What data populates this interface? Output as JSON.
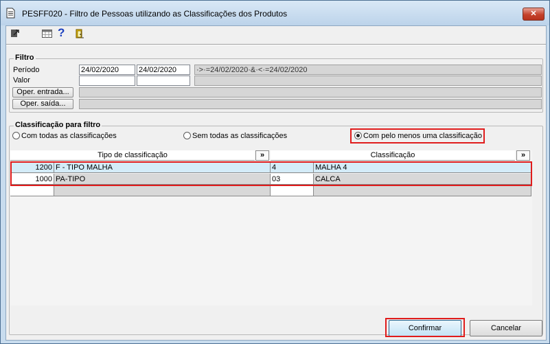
{
  "window": {
    "title": "PESFF020 - Filtro de Pessoas utilizando as Classificações dos Produtos",
    "close_label": "✕"
  },
  "toolbar": {
    "icons": [
      "exit-icon",
      "calendar-grid-icon",
      "help-icon",
      "door-icon"
    ],
    "help_label": "?"
  },
  "filtro": {
    "title": "Filtro",
    "periodo_label": "Período",
    "valor_label": "Valor",
    "date_from": "24/02/2020",
    "date_to": "24/02/2020",
    "expression": "·>·=24/02/2020·&·<·=24/02/2020",
    "valor_from": "",
    "valor_to": "",
    "oper_entrada_label": "Oper. entrada...",
    "oper_saida_label": "Oper. saída...",
    "oper_entrada_value": "",
    "oper_saida_value": ""
  },
  "classificacao": {
    "title": "Classificação para filtro",
    "options": [
      {
        "label": "Com todas as classificações",
        "selected": false
      },
      {
        "label": "Sem todas as classificações",
        "selected": false
      },
      {
        "label": "Com pelo menos uma classificação",
        "selected": true
      }
    ]
  },
  "grid": {
    "col_tipo": "Tipo de classificação",
    "col_class": "Classificação",
    "sort_label": "»",
    "rows": [
      {
        "tipo_code": "1200",
        "tipo_desc": "F - TIPO MALHA",
        "class_code": "4",
        "class_desc": "MALHA 4"
      },
      {
        "tipo_code": "1000",
        "tipo_desc": "PA-TIPO",
        "class_code": "03",
        "class_desc": "CALCA"
      },
      {
        "tipo_code": "",
        "tipo_desc": "",
        "class_code": "",
        "class_desc": ""
      }
    ]
  },
  "actions": {
    "confirm_label": "Confirmar",
    "cancel_label": "Cancelar"
  },
  "colors": {
    "highlight": "#e01b1b",
    "selected_row": "#d4ecf8",
    "window_frame": "#c8dcee"
  }
}
